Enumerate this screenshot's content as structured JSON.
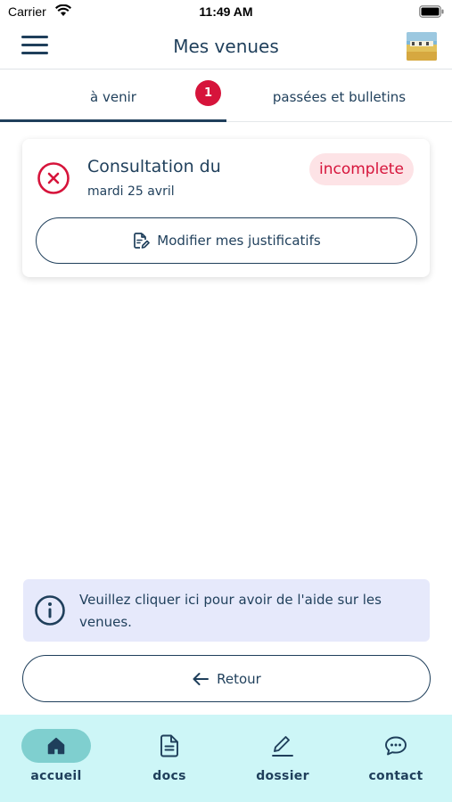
{
  "status_bar": {
    "carrier": "Carrier",
    "time": "11:49 AM"
  },
  "header": {
    "title": "Mes venues",
    "menu_icon": "hamburger-menu-icon",
    "avatar": "profile-photo"
  },
  "tabs": [
    {
      "label": "à venir",
      "badge": "1",
      "selected": true
    },
    {
      "label": "passées et bulletins",
      "selected": false
    }
  ],
  "visit_card": {
    "status_icon": "error-circle-icon",
    "title": "Consultation du",
    "date": "mardi 25 avril",
    "status": "incomplete",
    "action_label": "Modifier mes justificatifs",
    "action_icon": "edit-document-icon"
  },
  "help": {
    "icon": "info-icon",
    "text": "Veuillez cliquer ici pour avoir de l'aide sur les venues."
  },
  "back_button": {
    "label": "Retour",
    "icon": "arrow-left-icon"
  },
  "bottom_nav": [
    {
      "label": "accueil",
      "icon": "home-icon",
      "active": true
    },
    {
      "label": "docs",
      "icon": "document-icon",
      "active": false
    },
    {
      "label": "dossier",
      "icon": "pencil-icon",
      "active": false
    },
    {
      "label": "contact",
      "icon": "chat-bubble-icon",
      "active": false
    }
  ],
  "colors": {
    "primary": "#1f3f5b",
    "alert_red": "#d6143b",
    "alert_bg": "#fde3e6",
    "help_bg": "#e6e9fb",
    "nav_bg": "#cdf6f7",
    "nav_active": "#7fcfcf"
  }
}
